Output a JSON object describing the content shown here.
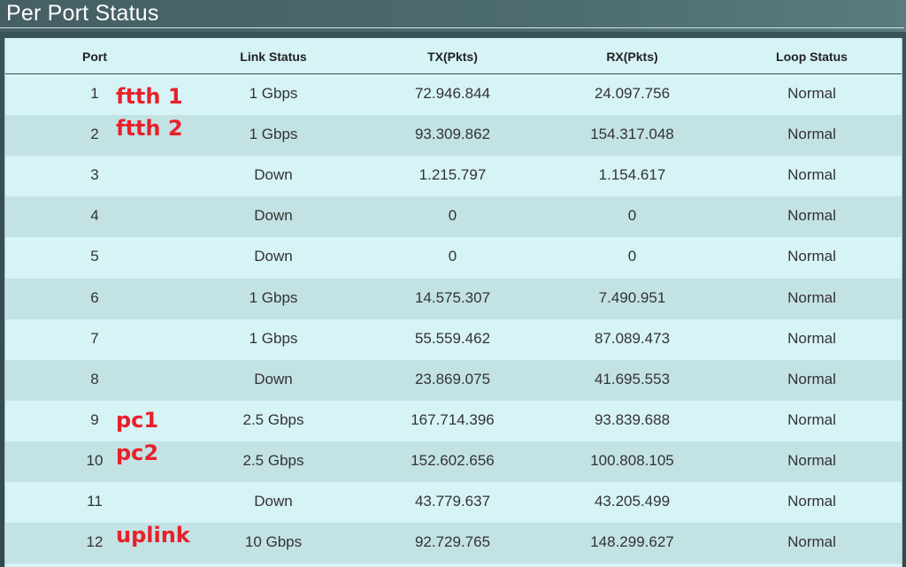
{
  "page": {
    "title": "Per Port Status"
  },
  "table": {
    "headers": {
      "port": "Port",
      "link_status": "Link Status",
      "tx": "TX(Pkts)",
      "rx": "RX(Pkts)",
      "loop_status": "Loop Status"
    },
    "rows": [
      {
        "port": "1",
        "link": "1 Gbps",
        "tx": "72.946.844",
        "rx": "24.097.756",
        "loop": "Normal",
        "note": "ftth 1"
      },
      {
        "port": "2",
        "link": "1 Gbps",
        "tx": "93.309.862",
        "rx": "154.317.048",
        "loop": "Normal",
        "note": "ftth 2"
      },
      {
        "port": "3",
        "link": "Down",
        "tx": "1.215.797",
        "rx": "1.154.617",
        "loop": "Normal",
        "note": ""
      },
      {
        "port": "4",
        "link": "Down",
        "tx": "0",
        "rx": "0",
        "loop": "Normal",
        "note": ""
      },
      {
        "port": "5",
        "link": "Down",
        "tx": "0",
        "rx": "0",
        "loop": "Normal",
        "note": ""
      },
      {
        "port": "6",
        "link": "1 Gbps",
        "tx": "14.575.307",
        "rx": "7.490.951",
        "loop": "Normal",
        "note": ""
      },
      {
        "port": "7",
        "link": "1 Gbps",
        "tx": "55.559.462",
        "rx": "87.089.473",
        "loop": "Normal",
        "note": ""
      },
      {
        "port": "8",
        "link": "Down",
        "tx": "23.869.075",
        "rx": "41.695.553",
        "loop": "Normal",
        "note": ""
      },
      {
        "port": "9",
        "link": "2.5 Gbps",
        "tx": "167.714.396",
        "rx": "93.839.688",
        "loop": "Normal",
        "note": "pc1"
      },
      {
        "port": "10",
        "link": "2.5 Gbps",
        "tx": "152.602.656",
        "rx": "100.808.105",
        "loop": "Normal",
        "note": "pc2"
      },
      {
        "port": "11",
        "link": "Down",
        "tx": "43.779.637",
        "rx": "43.205.499",
        "loop": "Normal",
        "note": ""
      },
      {
        "port": "12",
        "link": "10 Gbps",
        "tx": "92.729.765",
        "rx": "148.299.627",
        "loop": "Normal",
        "note": "uplink"
      }
    ]
  },
  "colors": {
    "annotation": "#e8202a",
    "row_light": "#d6f3f6",
    "row_dark": "#c3e2e4",
    "header_bar": "#455f64"
  }
}
